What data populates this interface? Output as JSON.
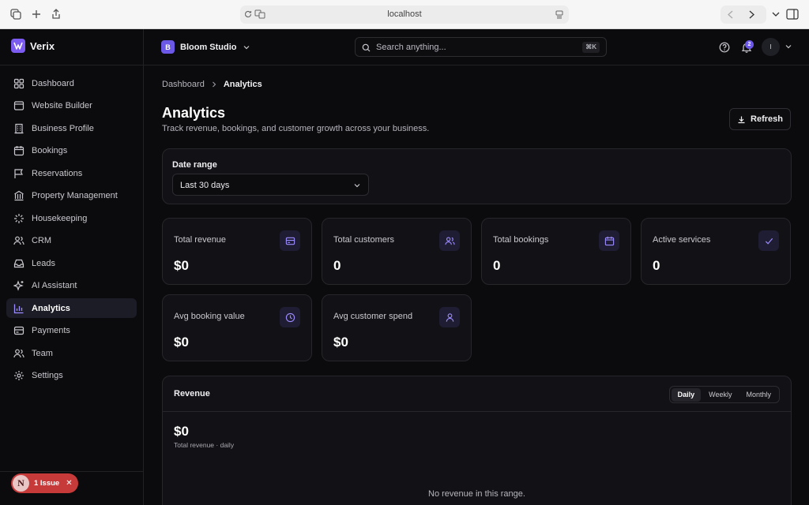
{
  "browser": {
    "url": "localhost"
  },
  "brand": {
    "name": "Verix"
  },
  "sidebar": {
    "items": [
      {
        "label": "Dashboard",
        "icon": "grid-icon"
      },
      {
        "label": "Website Builder",
        "icon": "browser-window-icon"
      },
      {
        "label": "Business Profile",
        "icon": "building-icon"
      },
      {
        "label": "Bookings",
        "icon": "calendar-icon"
      },
      {
        "label": "Reservations",
        "icon": "flag-icon"
      },
      {
        "label": "Property Management",
        "icon": "bank-icon"
      },
      {
        "label": "Housekeeping",
        "icon": "sparkle-burst-icon"
      },
      {
        "label": "CRM",
        "icon": "users-icon"
      },
      {
        "label": "Leads",
        "icon": "inbox-icon"
      },
      {
        "label": "AI Assistant",
        "icon": "sparkles-icon"
      },
      {
        "label": "Analytics",
        "icon": "bar-chart-icon",
        "active": true
      },
      {
        "label": "Payments",
        "icon": "credit-card-icon"
      },
      {
        "label": "Team",
        "icon": "team-icon"
      },
      {
        "label": "Settings",
        "icon": "gear-icon"
      }
    ]
  },
  "issue_badge": {
    "logo": "N",
    "label": "1 Issue"
  },
  "topbar": {
    "workspace_initial": "B",
    "workspace_name": "Bloom Studio",
    "search_placeholder": "Search anything...",
    "search_shortcut": "⌘K",
    "notification_count": "2",
    "avatar_initial": "I"
  },
  "breadcrumb": {
    "parent": "Dashboard",
    "current": "Analytics"
  },
  "page": {
    "title": "Analytics",
    "subtitle": "Track revenue, bookings, and customer growth across your business.",
    "refresh_label": "Refresh"
  },
  "date_range": {
    "label": "Date range",
    "value": "Last 30 days"
  },
  "stats": [
    {
      "label": "Total revenue",
      "value": "$0",
      "icon": "credit-card-icon"
    },
    {
      "label": "Total customers",
      "value": "0",
      "icon": "users-icon"
    },
    {
      "label": "Total bookings",
      "value": "0",
      "icon": "calendar-icon"
    },
    {
      "label": "Active services",
      "value": "0",
      "icon": "check-icon"
    },
    {
      "label": "Avg booking value",
      "value": "$0",
      "icon": "clock-icon"
    },
    {
      "label": "Avg customer spend",
      "value": "$0",
      "icon": "user-icon"
    }
  ],
  "revenue": {
    "title": "Revenue",
    "tabs": [
      "Daily",
      "Weekly",
      "Monthly"
    ],
    "active_tab": "Daily",
    "total": "$0",
    "caption": "Total revenue · daily",
    "empty_message": "No revenue in this range."
  },
  "colors": {
    "accent": "#7c5cf0",
    "issue": "#c63a3a",
    "background": "#0b0b0d"
  }
}
